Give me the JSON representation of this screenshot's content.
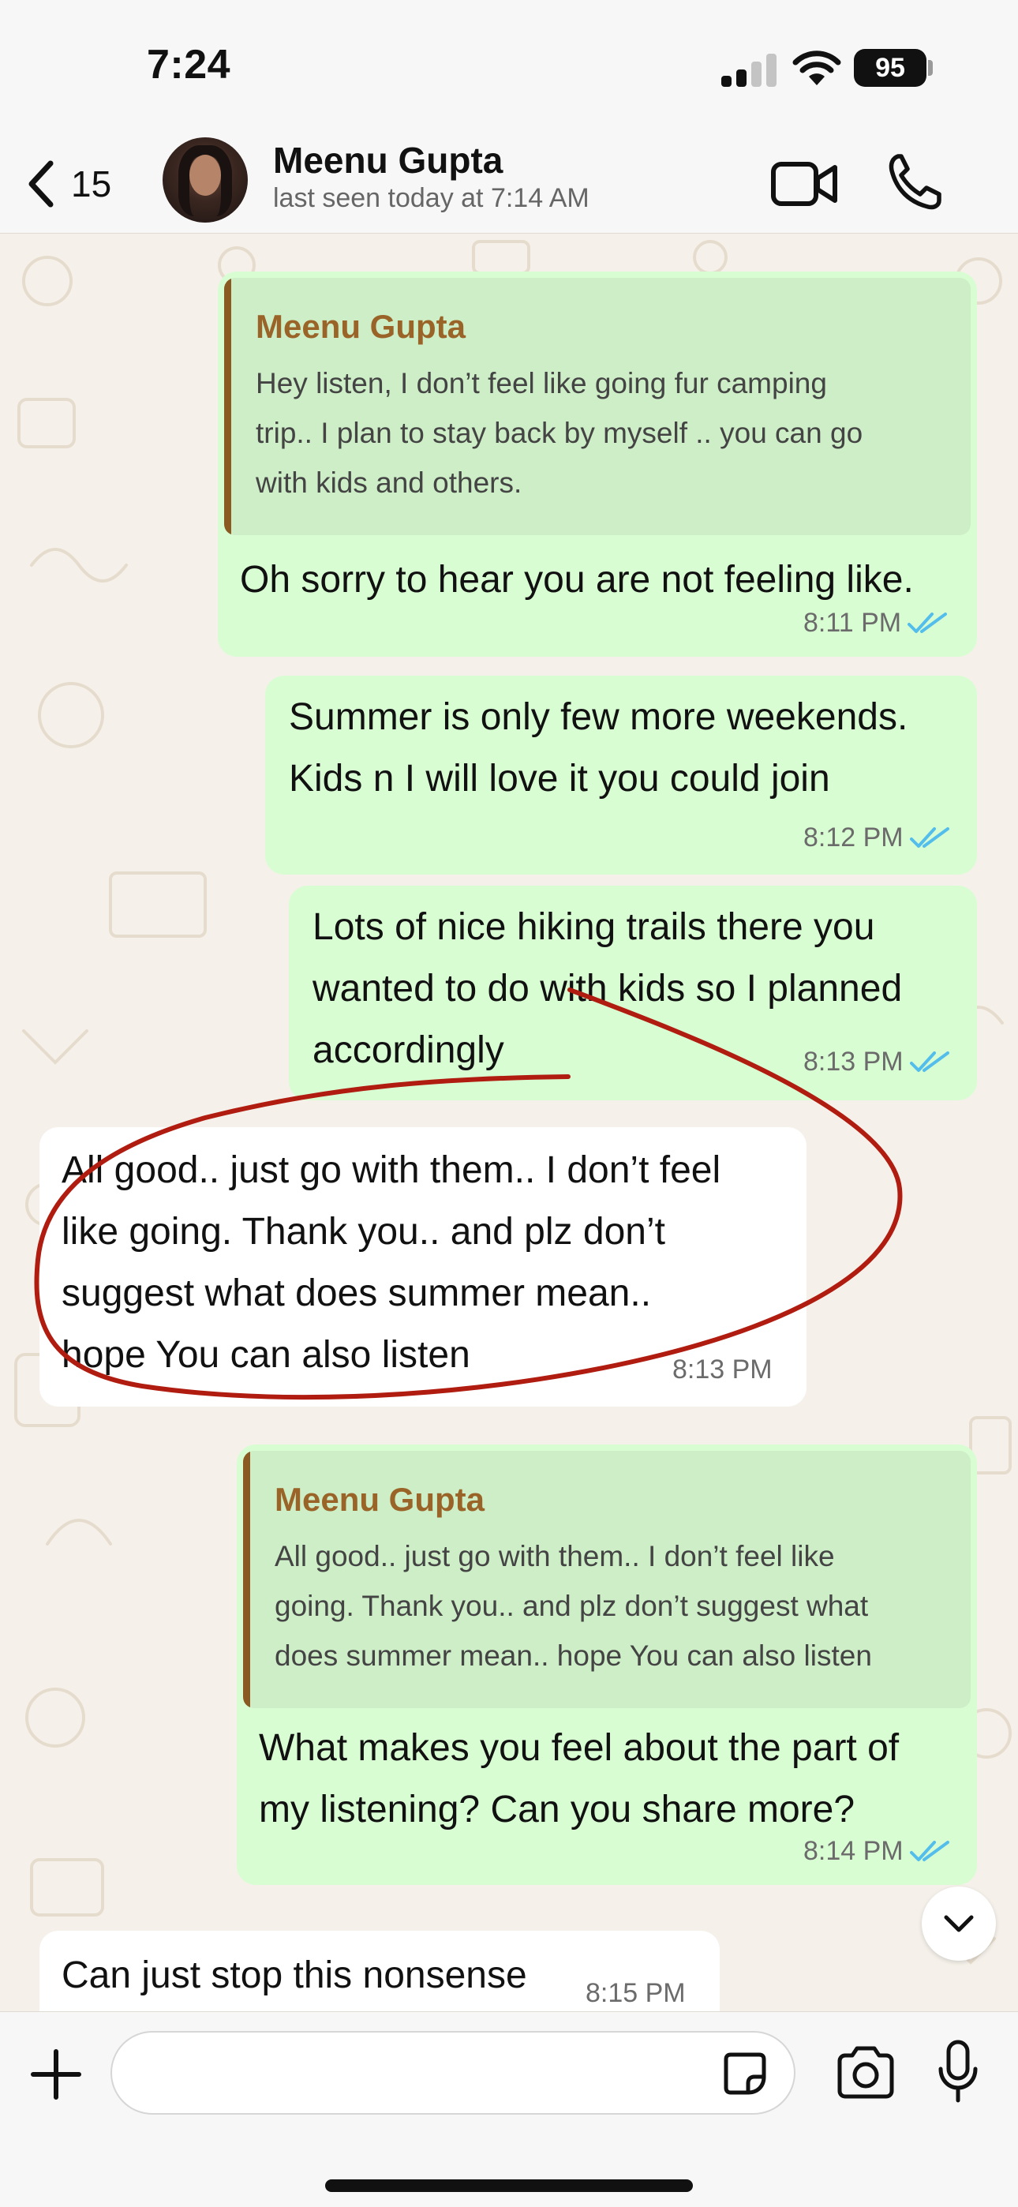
{
  "status_bar": {
    "time": "7:24",
    "battery": "95",
    "icons": [
      "cellular-signal-icon",
      "wifi-icon",
      "battery-icon"
    ]
  },
  "header": {
    "back_count": "15",
    "contact_name": "Meenu Gupta",
    "last_seen": "last seen today at 7:14 AM",
    "icons": [
      "chevron-left-icon",
      "video-camera-icon",
      "phone-icon"
    ]
  },
  "messages": [
    {
      "direction": "outgoing",
      "quote": {
        "author": "Meenu Gupta",
        "lines": [
          "Hey listen, I don’t feel like going fur camping",
          "trip.. I plan to stay back by myself .. you can go",
          "with kids and others."
        ]
      },
      "text_lines": [
        "Oh sorry to hear you are not feeling like."
      ],
      "time": "8:11 PM",
      "status": "read"
    },
    {
      "direction": "outgoing",
      "text_lines": [
        "Summer is only few more weekends.",
        "Kids n I will love it you could join"
      ],
      "time": "8:12 PM",
      "status": "read"
    },
    {
      "direction": "outgoing",
      "text_lines": [
        "Lots of nice hiking trails there you",
        "wanted to do with kids so I planned",
        "accordingly"
      ],
      "time": "8:13 PM",
      "status": "read"
    },
    {
      "direction": "incoming",
      "text_lines": [
        "All good.. just go with them.. I don’t feel",
        "like going. Thank you.. and plz don’t",
        "suggest what does summer mean..",
        "hope You can also listen"
      ],
      "time": "8:13 PM"
    },
    {
      "direction": "outgoing",
      "quote": {
        "author": "Meenu Gupta",
        "lines": [
          "All good.. just go with them.. I don’t feel like",
          "going. Thank you.. and plz don’t suggest what",
          "does summer mean.. hope You can also listen"
        ]
      },
      "text_lines": [
        "What makes you feel about the part of",
        "my listening? Can you share more?"
      ],
      "time": "8:14 PM",
      "status": "read"
    },
    {
      "direction": "incoming",
      "text_lines": [
        "Can just stop this nonsense"
      ],
      "time": "8:15 PM"
    }
  ],
  "input_bar": {
    "placeholder": "",
    "icons": [
      "plus-icon",
      "sticker-icon",
      "camera-icon",
      "microphone-icon"
    ]
  },
  "colors": {
    "outgoing_bubble": "#d9fdd3",
    "incoming_bubble": "#ffffff",
    "quote_bar": "#8a5a22",
    "quote_author": "#9a6428",
    "read_ticks": "#53bdeb",
    "annotation_circle": "#b01c10",
    "chat_background": "#f5f1ea"
  }
}
